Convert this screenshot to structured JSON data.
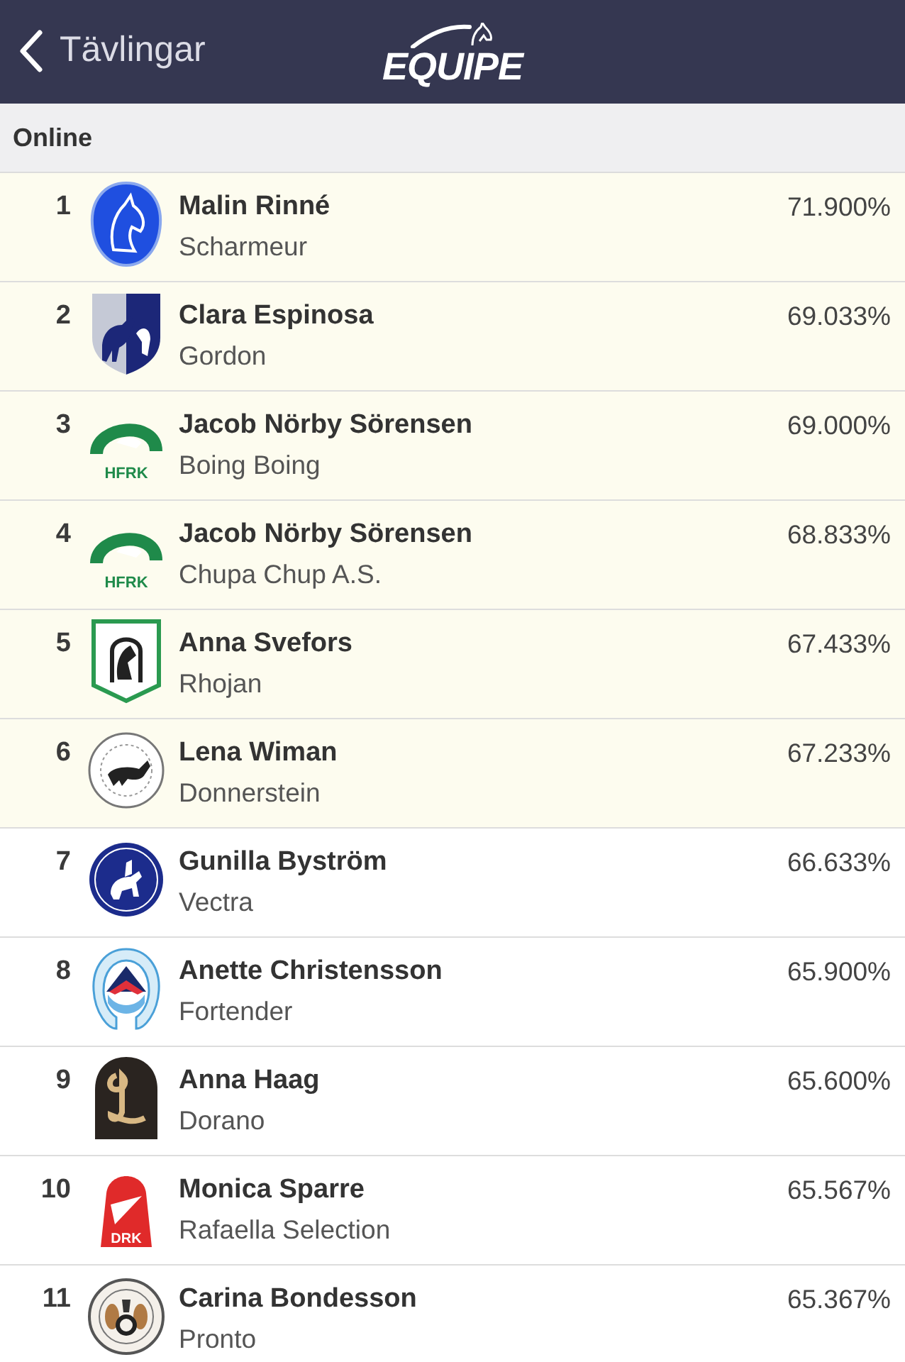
{
  "nav_bar": {
    "back_label": "Tävlingar",
    "logo": "EQUIPE"
  },
  "section": {
    "title": "Online"
  },
  "results": [
    {
      "rank": "1",
      "rider": "Malin Rinné",
      "horse": "Scharmeur",
      "score": "71.900%",
      "highlighted": true,
      "logo": {
        "kind": "horseshoe"
      }
    },
    {
      "rank": "2",
      "rider": "Clara Espinosa",
      "horse": "Gordon",
      "score": "69.033%",
      "highlighted": true,
      "logo": {
        "kind": "shield"
      }
    },
    {
      "rank": "3",
      "rider": "Jacob Nörby Sörensen",
      "horse": "Boing Boing",
      "score": "69.000%",
      "highlighted": true,
      "logo": {
        "kind": "arc",
        "text": "HFRK"
      }
    },
    {
      "rank": "4",
      "rider": "Jacob Nörby Sörensen",
      "horse": "Chupa Chup A.S.",
      "score": "68.833%",
      "highlighted": true,
      "logo": {
        "kind": "arc",
        "text": "HFRK"
      }
    },
    {
      "rank": "5",
      "rider": "Anna Svefors",
      "horse": "Rhojan",
      "score": "67.433%",
      "highlighted": true,
      "logo": {
        "kind": "framed-shield"
      }
    },
    {
      "rank": "6",
      "rider": "Lena Wiman",
      "horse": "Donnerstein",
      "score": "67.233%",
      "highlighted": true,
      "logo": {
        "kind": "seal"
      }
    },
    {
      "rank": "7",
      "rider": "Gunilla Byström",
      "horse": "Vectra",
      "score": "66.633%",
      "highlighted": false,
      "logo": {
        "kind": "badge"
      }
    },
    {
      "rank": "8",
      "rider": "Anette Christensson",
      "horse": "Fortender",
      "score": "65.900%",
      "highlighted": false,
      "logo": {
        "kind": "horseshoe-badge"
      }
    },
    {
      "rank": "9",
      "rider": "Anna Haag",
      "horse": "Dorano",
      "score": "65.600%",
      "highlighted": false,
      "logo": {
        "kind": "arch"
      }
    },
    {
      "rank": "10",
      "rider": "Monica Sparre",
      "horse": "Rafaella Selection",
      "score": "65.567%",
      "highlighted": false,
      "logo": {
        "kind": "stirrup",
        "text": "DRK"
      }
    },
    {
      "rank": "11",
      "rider": "Carina Bondesson",
      "horse": "Pronto",
      "score": "65.367%",
      "highlighted": false,
      "logo": {
        "kind": "crest"
      }
    }
  ]
}
